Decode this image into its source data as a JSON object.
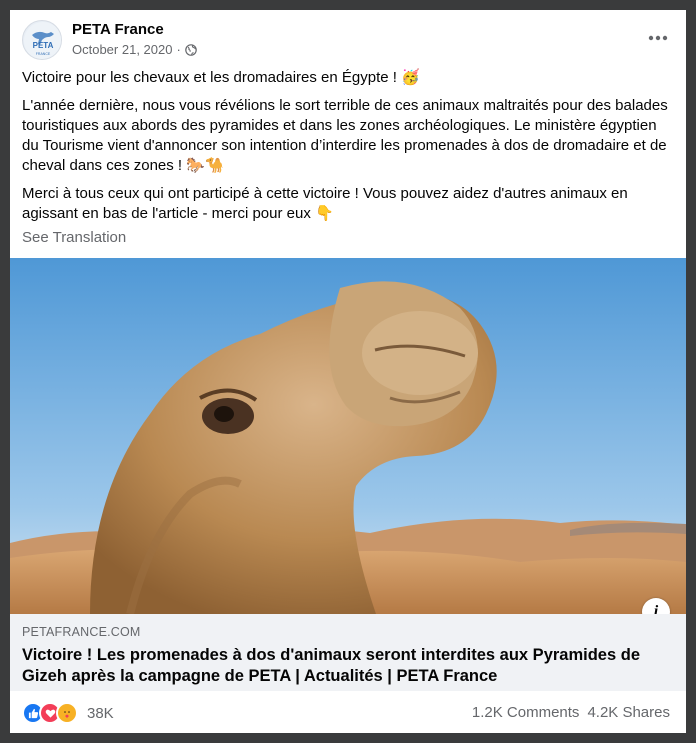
{
  "post": {
    "author": "PETA France",
    "avatar_text": "PETA",
    "avatar_subtext": "FRANCE",
    "date": "October 21, 2020",
    "date_separator": "·",
    "privacy_icon": "globe-icon",
    "more_icon": "more-options-icon",
    "paragraphs": [
      {
        "text": "Victoire pour les chevaux et les dromadaires en Égypte !",
        "emoji": "🥳"
      },
      {
        "text": "L'année dernière, nous vous révélions le sort terrible de ces animaux maltraités pour des balades touristiques aux abords des pyramides et dans les zones archéologiques. Le ministère égyptien du Tourisme vient d'annoncer son intention d’interdire les promenades à dos de dromadaire et de cheval dans ces zones !",
        "emoji": "🐎🐪"
      },
      {
        "text": "Merci à tous ceux qui ont participé à cette victoire ! Vous pouvez aidez d'autres animaux en agissant en bas de l'article - merci pour eux",
        "emoji": "👇"
      }
    ],
    "see_translation": "See Translation"
  },
  "link": {
    "image_description": "camel-photo",
    "info_label": "i",
    "domain": "PETAFRANCE.COM",
    "title": "Victoire ! Les promenades à dos d'animaux seront interdites aux Pyramides de Gizeh après la campagne de PETA | Actualités | PETA France"
  },
  "footer": {
    "reaction_icons": [
      "like-icon",
      "love-icon",
      "care-icon"
    ],
    "reaction_count": "38K",
    "comments": "1.2K Comments",
    "shares": "4.2K Shares"
  },
  "colors": {
    "like": "#1877f2",
    "love": "#f33e58",
    "secondary_text": "#65676b",
    "link_bg": "#f0f2f5"
  }
}
